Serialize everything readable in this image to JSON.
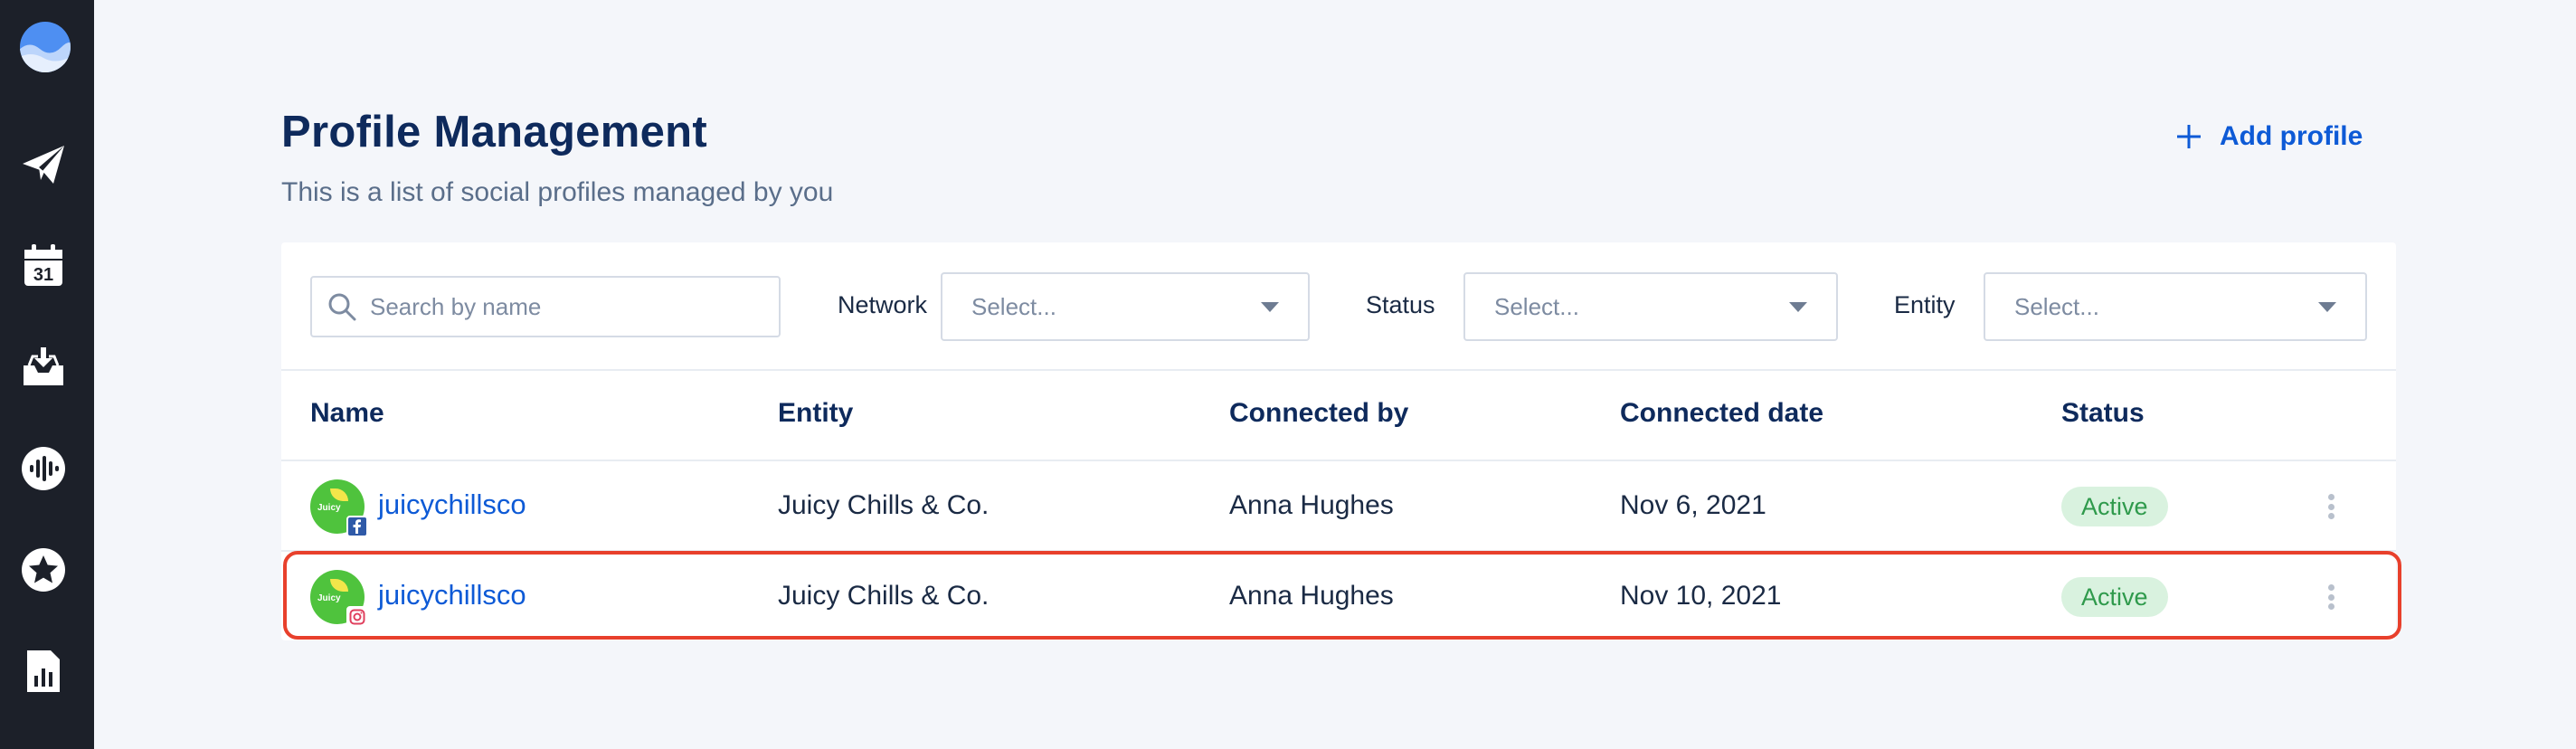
{
  "header": {
    "title": "Profile Management",
    "subtitle": "This is a list of social profiles managed by you",
    "add_profile_label": "Add profile"
  },
  "filters": {
    "search_placeholder": "Search by name",
    "network_label": "Network",
    "network_placeholder": "Select...",
    "status_label": "Status",
    "status_placeholder": "Select...",
    "entity_label": "Entity",
    "entity_placeholder": "Select..."
  },
  "table": {
    "columns": [
      "Name",
      "Entity",
      "Connected by",
      "Connected date",
      "Status"
    ],
    "rows": [
      {
        "name": "juicychillsco",
        "network": "facebook",
        "entity": "Juicy Chills & Co.",
        "connected_by": "Anna Hughes",
        "connected_date": "Nov 6, 2021",
        "status": "Active"
      },
      {
        "name": "juicychillsco",
        "network": "instagram",
        "entity": "Juicy Chills & Co.",
        "connected_by": "Anna Hughes",
        "connected_date": "Nov 10, 2021",
        "status": "Active"
      }
    ]
  },
  "sidebar": {
    "icons": [
      "logo-icon",
      "send-icon",
      "calendar-icon",
      "inbox-icon",
      "listening-icon",
      "reviews-icon",
      "reports-icon"
    ],
    "calendar_day": "31"
  },
  "colors": {
    "sidebar_bg": "#1c2029",
    "accent": "#0d5ad6",
    "status_active_bg": "#d9f2df",
    "status_active_text": "#2f9a4c",
    "highlight": "#e8402c"
  }
}
